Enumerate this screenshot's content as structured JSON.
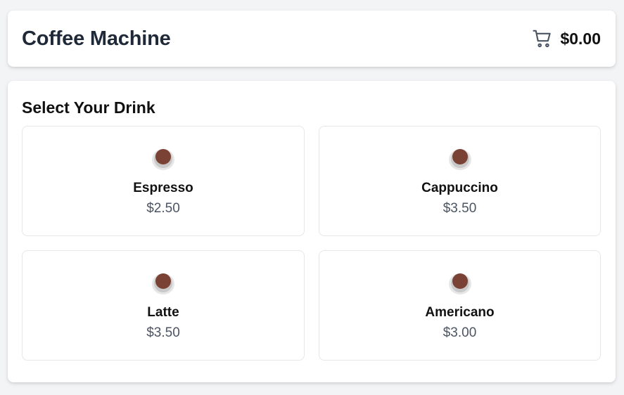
{
  "header": {
    "title": "Coffee Machine",
    "cart_icon": "cart-icon",
    "cart_total": "$0.00"
  },
  "menu": {
    "heading": "Select Your Drink",
    "item_icon": "coffee-cup-icon",
    "drinks": [
      {
        "name": "Espresso",
        "price": "$2.50"
      },
      {
        "name": "Cappuccino",
        "price": "$3.50"
      },
      {
        "name": "Latte",
        "price": "$3.50"
      },
      {
        "name": "Americano",
        "price": "$3.00"
      }
    ]
  },
  "colors": {
    "background": "#f3f4f6",
    "card": "#ffffff",
    "border": "#e5e7eb",
    "title": "#1f2937",
    "price": "#4b5563",
    "coffee": "#7a4234"
  }
}
